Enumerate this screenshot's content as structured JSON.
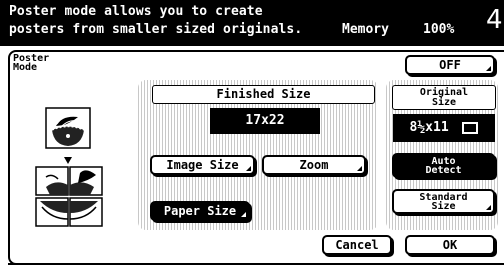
{
  "header": {
    "line1": "Poster mode allows you to create",
    "line2": "posters from smaller sized originals.",
    "memory_label": "Memory",
    "memory_value": "100%",
    "page_number": "4"
  },
  "mode": {
    "label_line1": "Poster",
    "label_line2": "Mode"
  },
  "off_button": "OFF",
  "finished_size": {
    "header": "Finished Size",
    "value": "17x22",
    "image_size_button": "Image Size",
    "zoom_button": "Zoom",
    "paper_size_button": "Paper Size"
  },
  "original_size": {
    "header_line1": "Original",
    "header_line2": "Size",
    "value": "8½x11",
    "orientation_icon": "portrait-page-icon",
    "auto_detect_line1": "Auto",
    "auto_detect_line2": "Detect",
    "standard_size_line1": "Standard",
    "standard_size_line2": "Size"
  },
  "footer": {
    "cancel_button": "Cancel",
    "ok_button": "OK"
  },
  "icons": {
    "preview_single": "banana-bowl-icon",
    "preview_tiled": "banana-bowl-poster-tiles-icon",
    "arrow": "down-arrow-icon"
  }
}
